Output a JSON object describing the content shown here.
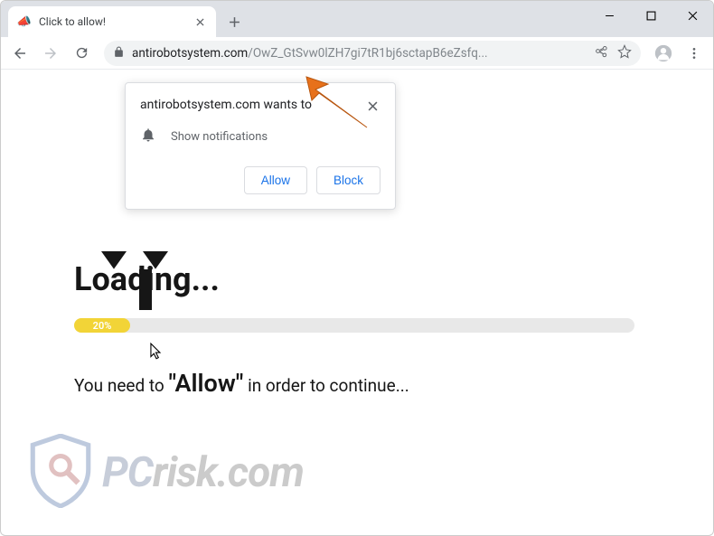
{
  "window": {
    "tab_title": "Click to allow!"
  },
  "toolbar": {
    "url_domain": "antirobotsystem.com",
    "url_path": "/OwZ_GtSvw0lZH7gi7tR1bj6sctapB6eZsfq..."
  },
  "notification": {
    "origin": "antirobotsystem.com wants to",
    "permission": "Show notifications",
    "allow_label": "Allow",
    "block_label": "Block"
  },
  "page": {
    "heading": "Loading...",
    "progress_percent": "20%",
    "instruction_prefix": "You need to ",
    "instruction_quote": "\"Allow\"",
    "instruction_suffix": " in order to continue..."
  },
  "watermark": {
    "text_left": "PC",
    "text_right": "risk.com"
  },
  "colors": {
    "accent_blue": "#1a73e8",
    "progress_yellow": "#f2d437",
    "pointer_orange": "#e7711b"
  }
}
